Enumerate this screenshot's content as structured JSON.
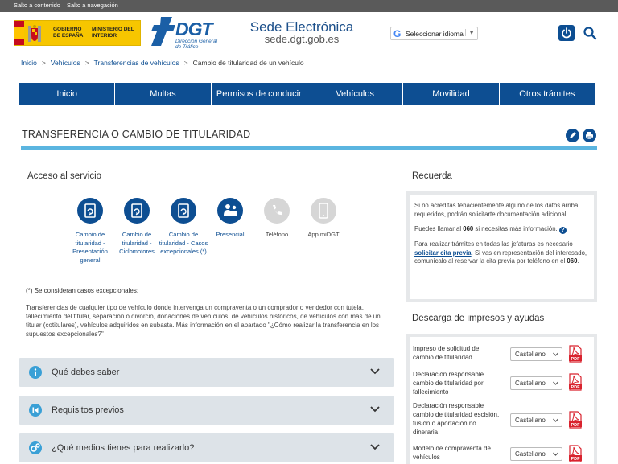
{
  "skip_links": {
    "content": "Salto a contenido",
    "nav": "Salto a navegación"
  },
  "header": {
    "gov_line1": "GOBIERNO DE ESPAÑA",
    "gov_line2": "MINISTERIO DEL INTERIOR",
    "dgt_brand": "DGT",
    "dgt_sub": "Dirección General de Tráfico",
    "site_title": "Sede Electrónica",
    "site_url": "sede.dgt.gob.es",
    "lang_label": "Seleccionar idioma"
  },
  "breadcrumb": {
    "items": [
      "Inicio",
      "Vehículos",
      "Transferencias de vehículos"
    ],
    "current": "Cambio de titularidad de un vehículo"
  },
  "nav": [
    "Inicio",
    "Multas",
    "Permisos de conducir",
    "Vehículos",
    "Movilidad",
    "Otros trámites"
  ],
  "page": {
    "title": "TRANSFERENCIA O CAMBIO DE TITULARIDAD"
  },
  "acceso": {
    "title": "Acceso al servicio",
    "services": [
      {
        "label": "Cambio de titularidad - Presentación general",
        "icon": "document-edit-icon",
        "enabled": true
      },
      {
        "label": "Cambio de titularidad - Ciclomotores",
        "icon": "document-edit-icon",
        "enabled": true
      },
      {
        "label": "Cambio de titularidad - Casos excepcionales (*)",
        "icon": "document-edit-icon",
        "enabled": true
      },
      {
        "label": "Presencial",
        "icon": "in-person-icon",
        "enabled": true
      },
      {
        "label": "Teléfono",
        "icon": "phone-icon",
        "enabled": false
      },
      {
        "label": "App miDGT",
        "icon": "mobile-app-icon",
        "enabled": false
      }
    ],
    "note_head": "(*) Se consideran casos excepcionales:",
    "note_body": "Transferencias de cualquier tipo de vehículo donde intervenga un compraventa o un comprador o vendedor con tutela, fallecimiento del titular, separación o divorcio, donaciones de vehículos, de vehículos históricos, de vehículos con más de un titular (cotitulares), vehículos adquiridos en subasta. Más información en el apartado \"¿Cómo realizar la transferencia en los supuestos excepcionales?\""
  },
  "accordions": [
    {
      "label": "Qué debes saber",
      "icon": "info-icon"
    },
    {
      "label": "Requisitos previos",
      "icon": "skip-back-icon"
    },
    {
      "label": "¿Qué medios tienes para realizarlo?",
      "icon": "gears-icon"
    }
  ],
  "recuerda": {
    "title": "Recuerda",
    "p1": "Si no acreditas fehacientemente alguno de los datos arriba requeridos, podrán solicitarte documentación adicional.",
    "p2_pre": "Puedes llamar al ",
    "p2_num": "060",
    "p2_post": " si necesitas más información.",
    "p3_pre": "Para realizar trámites en todas las jefaturas es necesario ",
    "p3_link": "solicitar cita previa",
    "p3_mid": ". Si vas en representación del interesado, comunícalo al reservar la cita previa por teléfono en el ",
    "p3_num": "060",
    "p3_end": "."
  },
  "descarga": {
    "title": "Descarga de impresos y ayudas",
    "rows": [
      {
        "label": "Impreso de solicitud de cambio de titularidad",
        "lang": "Castellano"
      },
      {
        "label": "Declaración responsable cambio de titularidad por fallecimiento",
        "lang": "Castellano"
      },
      {
        "label": "Declaración responsable cambio de titularidad escisión, fusión o aportación no dineraria",
        "lang": "Castellano"
      },
      {
        "label": "Modelo de compraventa de vehículos",
        "lang": "Castellano"
      }
    ]
  },
  "colors": {
    "primary": "#0d4e92",
    "accent_rule": "#5bb5e0",
    "accordion_bg": "#dde3e8",
    "pdf_red": "#d9232e"
  }
}
